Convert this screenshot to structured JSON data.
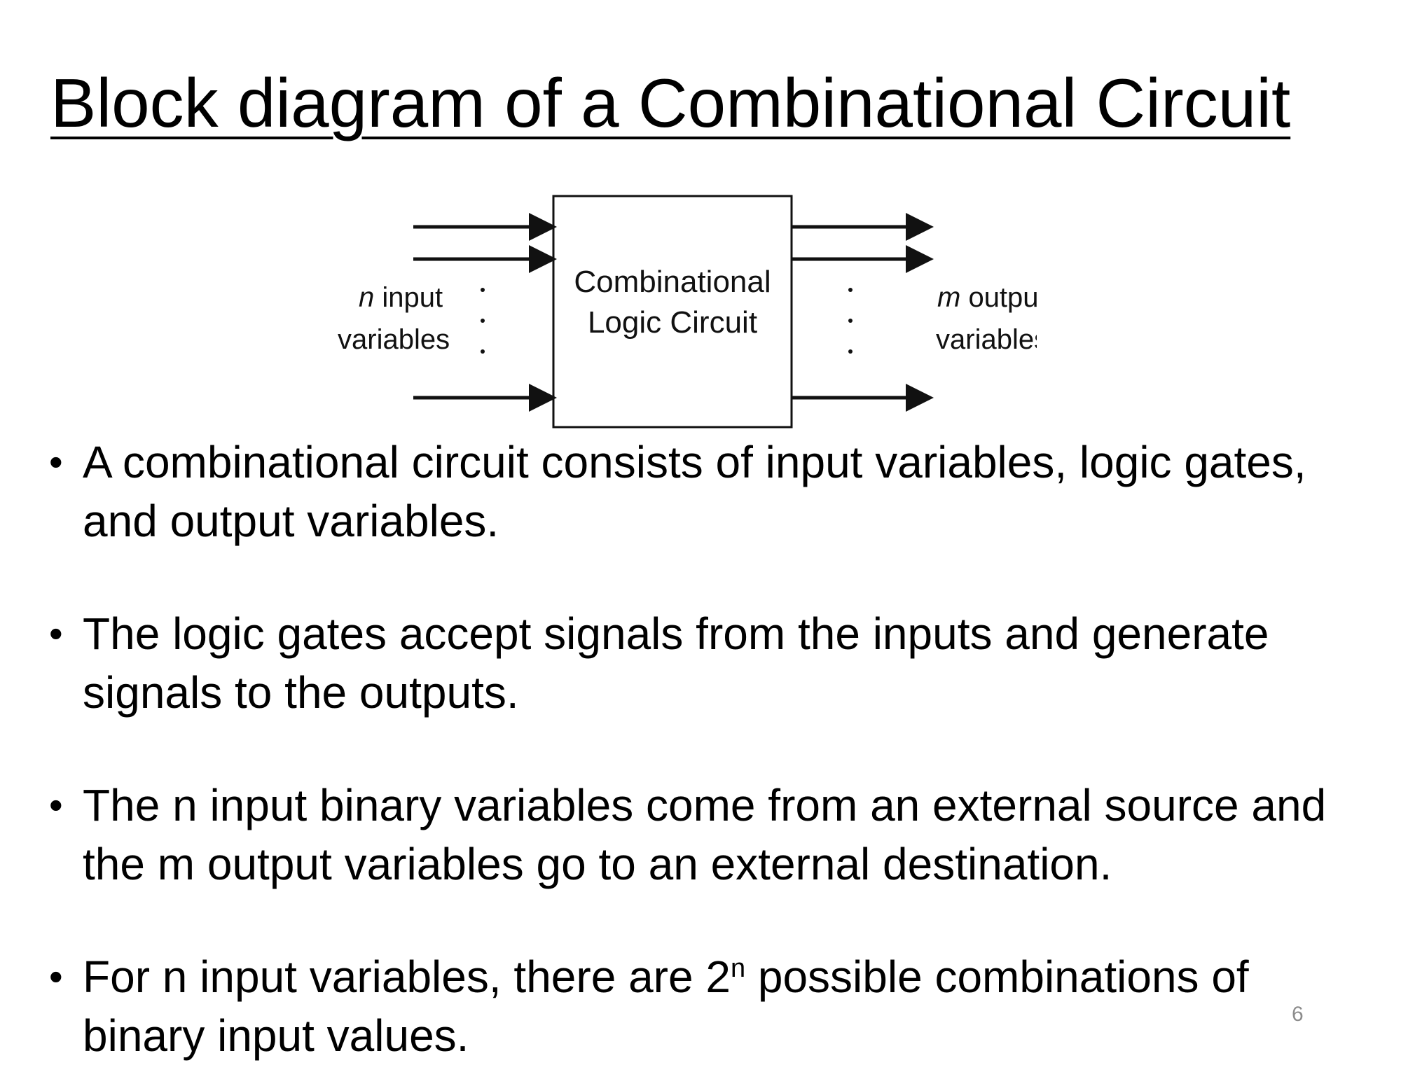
{
  "slide": {
    "title": "Block diagram of a Combinational Circuit",
    "number": "6"
  },
  "diagram": {
    "block_label_line1": "Combinational",
    "block_label_line2": "Logic Circuit",
    "input_label_italic": "n",
    "input_label_line1": " input",
    "input_label_line2": "variables",
    "output_label_italic": "m",
    "output_label_line1": " output",
    "output_label_line2": "variables"
  },
  "bullets": [
    {
      "text": "A combinational circuit consists of input variables, logic gates, and output variables."
    },
    {
      "text": "The logic gates accept signals from the inputs and generate signals to the outputs."
    },
    {
      "text": "The n input binary variables come from an external source and the m output variables go to an external destination."
    },
    {
      "text_before": "For n input variables, there are 2",
      "superscript": "n",
      "text_after": " possible combinations of binary input values."
    }
  ],
  "bullet_symbol": "•"
}
